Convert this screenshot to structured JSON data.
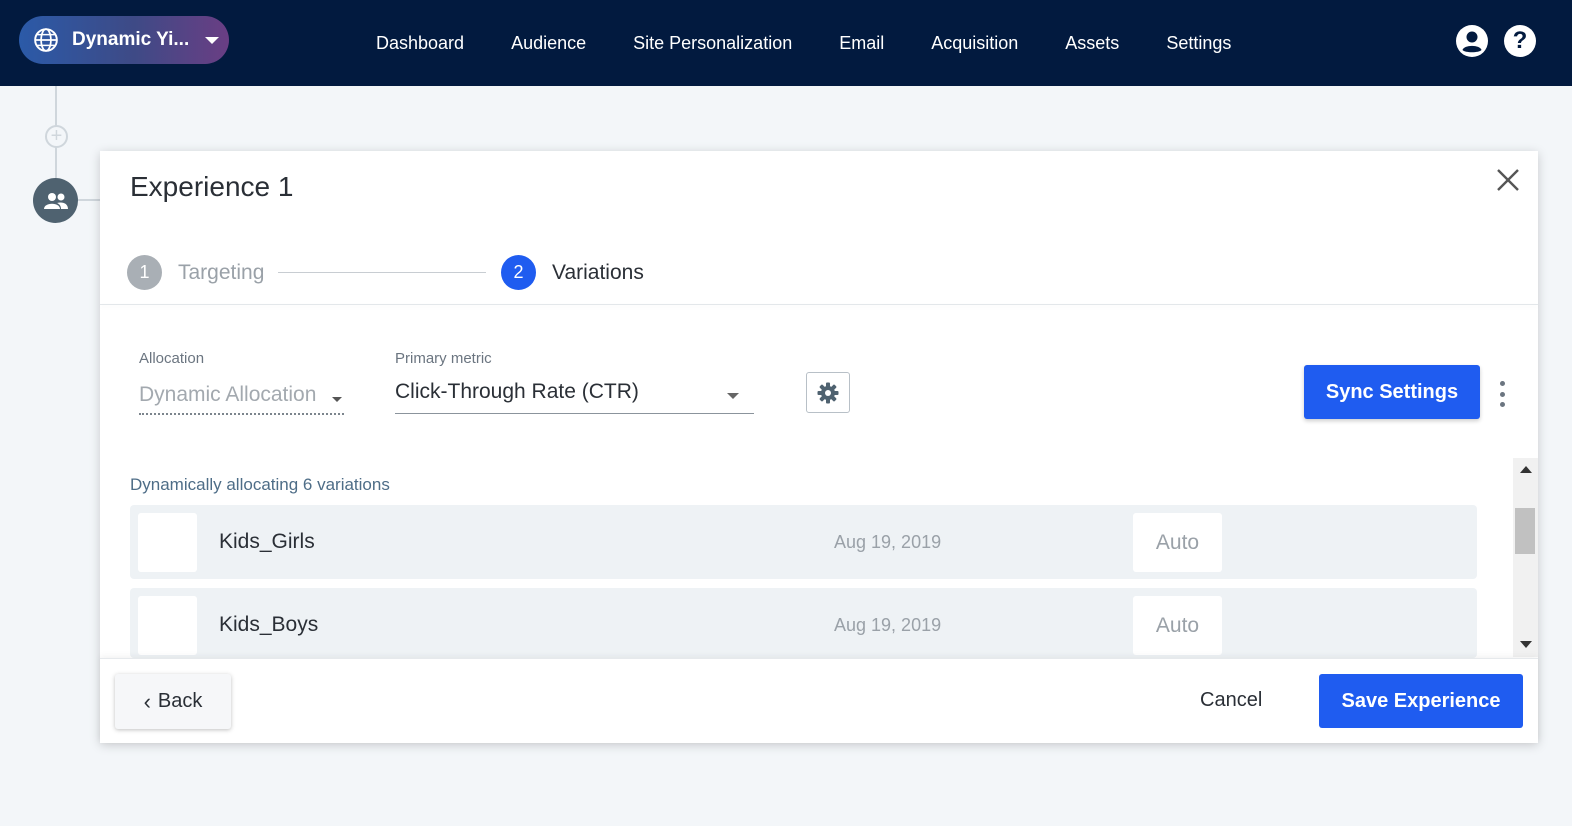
{
  "topbar": {
    "site_name": "Dynamic Yi...",
    "nav": [
      "Dashboard",
      "Audience",
      "Site Personalization",
      "Email",
      "Acquisition",
      "Assets",
      "Settings"
    ]
  },
  "modal": {
    "title": "Experience 1",
    "steps": [
      {
        "number": "1",
        "label": "Targeting"
      },
      {
        "number": "2",
        "label": "Variations"
      }
    ],
    "allocation": {
      "label": "Allocation",
      "value": "Dynamic Allocation"
    },
    "primary_metric": {
      "label": "Primary metric",
      "value": "Click-Through Rate (CTR)"
    },
    "sync_button": "Sync Settings",
    "summary": "Dynamically allocating 6 variations",
    "variations": [
      {
        "name": "Kids_Girls",
        "date": "Aug 19, 2019",
        "allocation": "Auto"
      },
      {
        "name": "Kids_Boys",
        "date": "Aug 19, 2019",
        "allocation": "Auto"
      }
    ],
    "footer": {
      "back": "Back",
      "cancel": "Cancel",
      "save": "Save Experience"
    }
  },
  "colors": {
    "nav_bg": "#021a3f",
    "primary": "#1f5cf0"
  }
}
